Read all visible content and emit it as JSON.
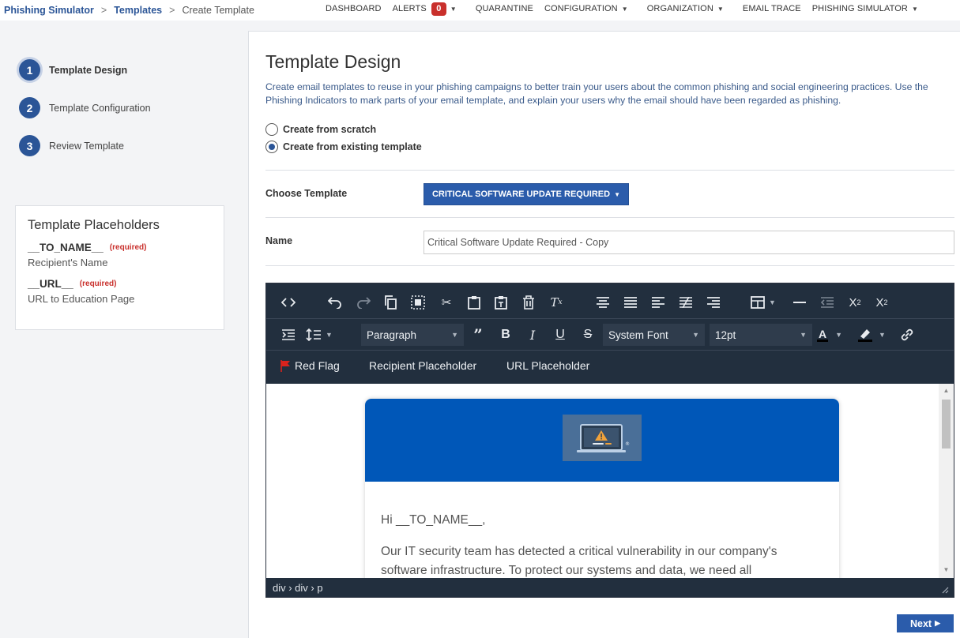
{
  "breadcrumb": {
    "items": [
      "Phishing Simulator",
      "Templates"
    ],
    "current": "Create Template",
    "separator": ">"
  },
  "topnav": {
    "dashboard": "DASHBOARD",
    "alerts": "ALERTS",
    "alerts_count": "0",
    "quarantine": "QUARANTINE",
    "configuration": "CONFIGURATION",
    "organization": "ORGANIZATION",
    "email_trace": "EMAIL TRACE",
    "phishing_simulator": "PHISHING SIMULATOR"
  },
  "steps": [
    {
      "number": "1",
      "label": "Template Design"
    },
    {
      "number": "2",
      "label": "Template Configuration"
    },
    {
      "number": "3",
      "label": "Review Template"
    }
  ],
  "placeholders": {
    "title": "Template Placeholders",
    "required_label": "(required)",
    "items": [
      {
        "token": "__TO_NAME__",
        "description": "Recipient's Name"
      },
      {
        "token": "__URL__",
        "description": "URL to Education Page"
      }
    ]
  },
  "main": {
    "title": "Template Design",
    "intro": "Create email templates to reuse in your phishing campaigns to better train your users about the common phishing and social engineering practices. Use the Phishing Indicators to mark parts of your email template, and explain your users why the email should have been regarded as phishing.",
    "radio_scratch": "Create from scratch",
    "radio_existing": "Create from existing template",
    "choose_label": "Choose Template",
    "choose_value": "CRITICAL SOFTWARE UPDATE REQUIRED",
    "name_label": "Name",
    "name_value": "Critical Software Update Required - Copy",
    "next_label": "Next"
  },
  "editor": {
    "block_format": "Paragraph",
    "font_family": "System Font",
    "font_size": "12pt",
    "custom_buttons": [
      "Red Flag",
      "Recipient Placeholder",
      "URL Placeholder"
    ],
    "status_path": "div › div › p",
    "email": {
      "greeting": "Hi __TO_NAME__,",
      "body": "Our IT security team has detected a critical vulnerability in our company's software infrastructure. To protect our systems and data, we need all"
    }
  },
  "colors": {
    "accent": "#2b5597",
    "toolbar": "#222f3e",
    "banner": "#0057b8",
    "required": "#c9302c"
  }
}
